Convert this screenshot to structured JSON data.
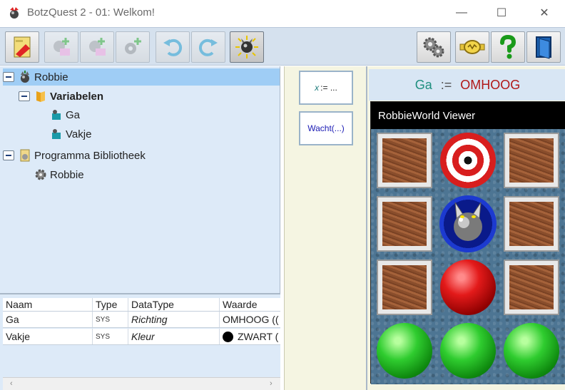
{
  "window": {
    "title": "BotzQuest 2 - 01: Welkom!",
    "minimize_glyph": "—",
    "maximize_glyph": "☐",
    "close_glyph": "✕"
  },
  "toolbar": {
    "buttons": [
      {
        "name": "edit-level-button",
        "icon": "level-icon",
        "disabled": false
      },
      {
        "name": "add-variable-button",
        "icon": "add-variable-icon",
        "disabled": true
      },
      {
        "name": "add-procedure-button",
        "icon": "add-procedure-icon",
        "disabled": true
      },
      {
        "name": "add-gear-button",
        "icon": "add-gear-icon",
        "disabled": true
      },
      {
        "name": "undo-button",
        "icon": "undo-icon",
        "disabled": true
      },
      {
        "name": "redo-button",
        "icon": "redo-icon",
        "disabled": true
      },
      {
        "name": "run-button",
        "icon": "robot-run-icon",
        "disabled": false
      },
      {
        "name": "settings-button",
        "icon": "gears-icon",
        "disabled": false
      },
      {
        "name": "achievements-button",
        "icon": "badge-icon",
        "disabled": false
      },
      {
        "name": "help-button",
        "icon": "question-icon",
        "disabled": false
      },
      {
        "name": "exit-button",
        "icon": "door-icon",
        "disabled": false
      }
    ]
  },
  "tree": {
    "root_label": "Robbie",
    "variables_label": "Variabelen",
    "variables": [
      "Ga",
      "Vakje"
    ],
    "library_label": "Programma Bibliotheek",
    "library_items": [
      "Robbie"
    ]
  },
  "props": {
    "headers": {
      "naam": "Naam",
      "type": "Type",
      "datatype": "DataType",
      "waarde": "Waarde"
    },
    "rows": [
      {
        "naam": "Ga",
        "type": "SYS",
        "datatype": "Richting",
        "waarde": "OMHOOG (("
      },
      {
        "naam": "Vakje",
        "type": "SYS",
        "datatype": "Kleur",
        "waarde": "ZWART ("
      }
    ],
    "scroll_left": "‹",
    "scroll_right": "›"
  },
  "palette": {
    "assign_var": "x",
    "assign_rest": ":= ...",
    "wait_label": "Wacht(...)"
  },
  "code": {
    "var": "Ga",
    "op": ":=",
    "value": "OMHOOG"
  },
  "viewer": {
    "title": "RobbieWorld Viewer",
    "grid": [
      [
        "crate",
        "target",
        "crate"
      ],
      [
        "crate",
        "robot",
        "crate"
      ],
      [
        "crate",
        "red-ball",
        "crate"
      ],
      [
        "green-ball",
        "green-ball",
        "green-ball"
      ]
    ]
  },
  "colors": {
    "toolbar_bg": "#d5e1ee",
    "tree_bg": "#ddeaf8",
    "selection": "#9fcdf5",
    "palette_bg": "#f5f5e2",
    "code_var": "#1f8f7f",
    "code_value": "#b01818",
    "cmd_text": "#1a1ab4"
  }
}
